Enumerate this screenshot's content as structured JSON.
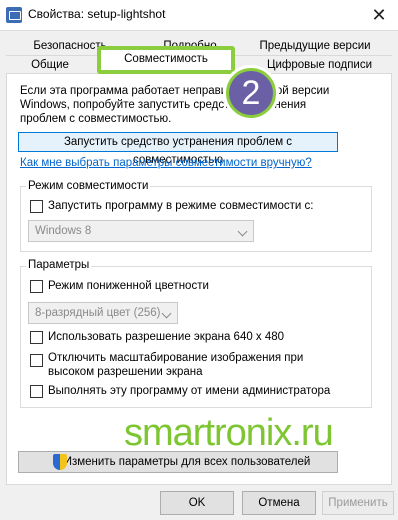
{
  "window": {
    "title": "Свойства: setup-lightshot",
    "close": "✕"
  },
  "tabs": {
    "row1": [
      "Безопасность",
      "Подробно",
      "Предыдущие версии"
    ],
    "row2": [
      "Общие",
      "Совместимость",
      "Цифровые подписи"
    ],
    "active": "Совместимость"
  },
  "badge": {
    "number": "2"
  },
  "intro": {
    "text": "Если эта программа работает неправильно в этой версии Windows, попробуйте запустить средство устранения проблем с совместимостью."
  },
  "troubleshoot_button": "Запустить средство устранения проблем с совместимостью",
  "manual_link": "Как мне выбрать параметры совместимости вручную?",
  "compat_mode": {
    "group_label": "Режим совместимости",
    "checkbox_label": "Запустить программу в режиме совместимости с:",
    "select_value": "Windows 8"
  },
  "parameters": {
    "group_label": "Параметры",
    "reduced_color_label": "Режим пониженной цветности",
    "color_select_value": "8-разрядный цвет (256)",
    "res_640_label": "Использовать разрешение экрана 640 x 480",
    "dpi_label": "Отключить масштабирование изображения при высоком разрешении экрана",
    "admin_label": "Выполнять эту программу от имени администратора"
  },
  "watermark": "smartronix.ru",
  "all_users_button": "Изменить параметры для всех пользователей",
  "footer": {
    "ok": "OK",
    "cancel": "Отмена",
    "apply": "Применить"
  }
}
